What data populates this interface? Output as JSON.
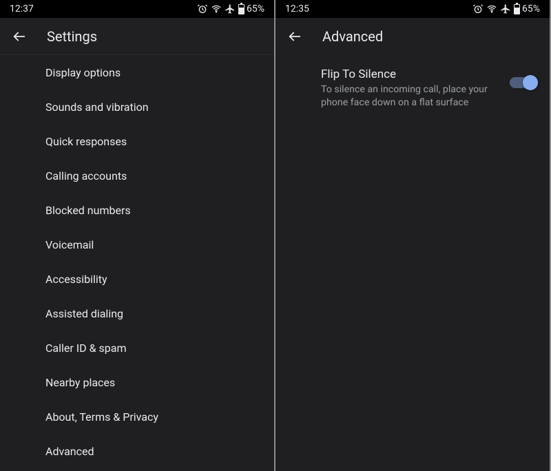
{
  "left": {
    "status": {
      "time": "12:37",
      "battery": "65%"
    },
    "header": {
      "title": "Settings"
    },
    "items": [
      "Display options",
      "Sounds and vibration",
      "Quick responses",
      "Calling accounts",
      "Blocked numbers",
      "Voicemail",
      "Accessibility",
      "Assisted dialing",
      "Caller ID & spam",
      "Nearby places",
      "About, Terms & Privacy",
      "Advanced"
    ]
  },
  "right": {
    "status": {
      "time": "12:35",
      "battery": "65%"
    },
    "header": {
      "title": "Advanced"
    },
    "flip": {
      "title": "Flip To Silence",
      "desc": "To silence an incoming call, place your phone face down on a flat surface",
      "enabled": true
    }
  }
}
